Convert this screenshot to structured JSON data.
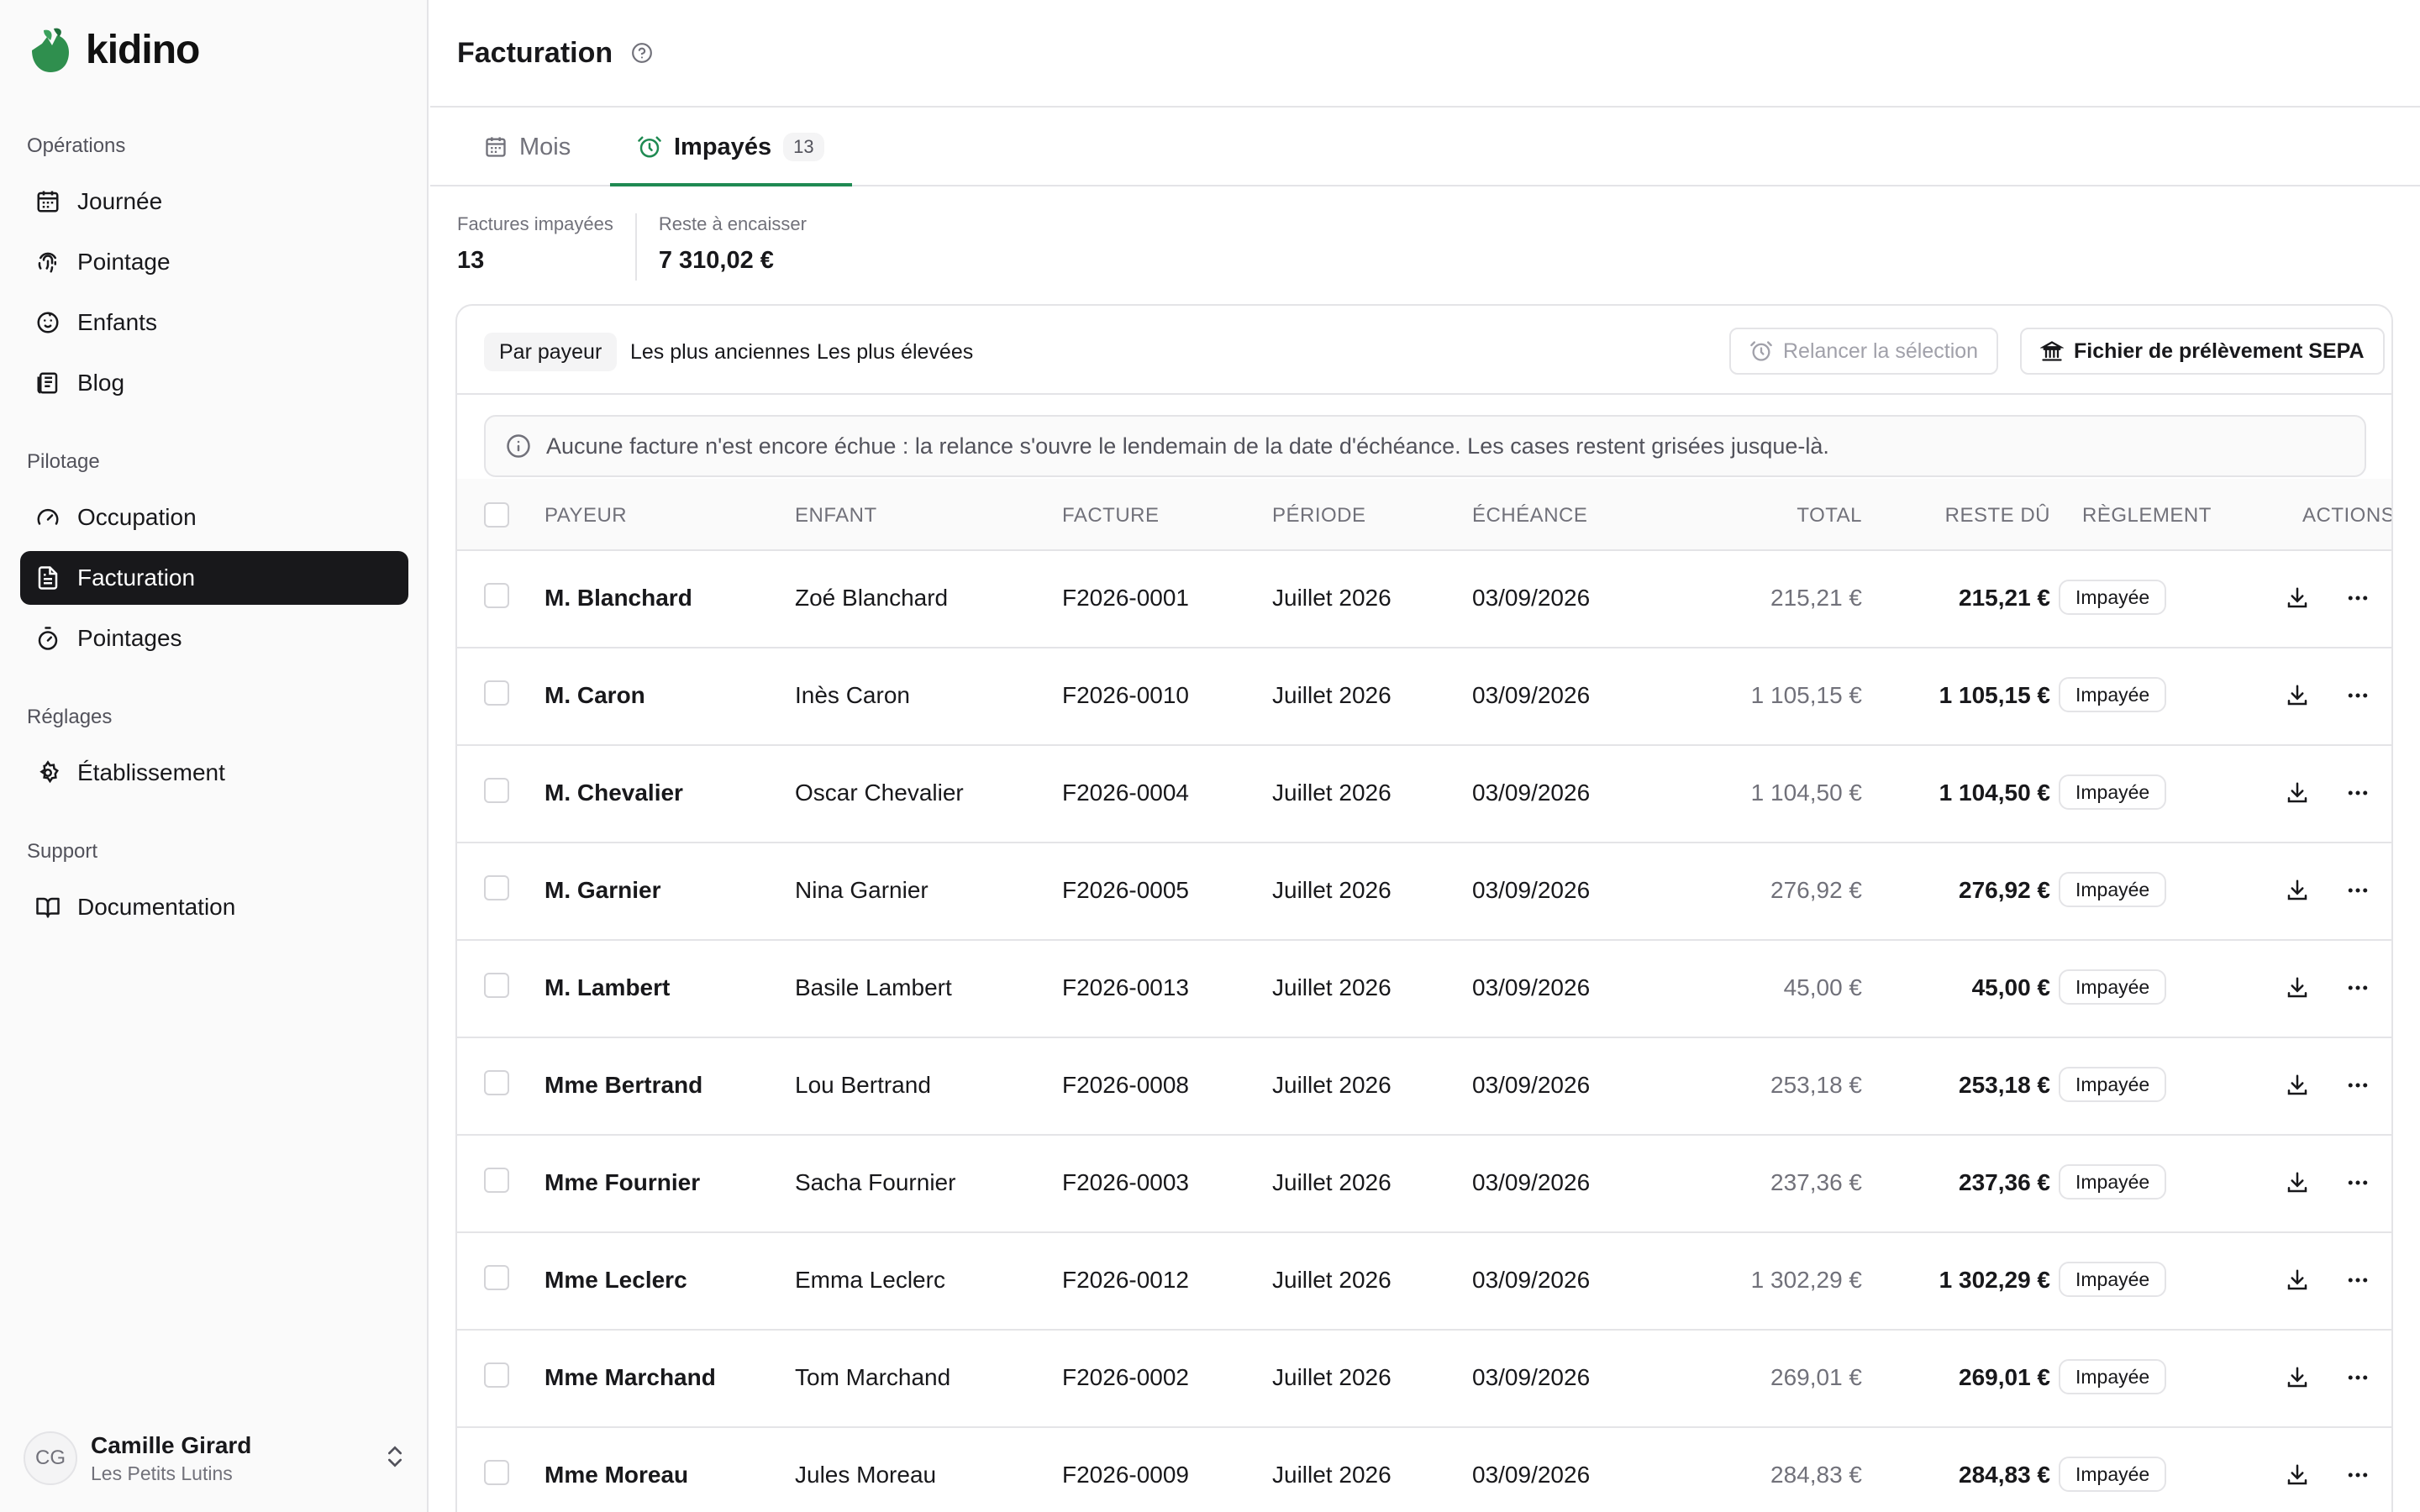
{
  "brand": {
    "name": "kidino",
    "accent": "#2f8f4e"
  },
  "sidebar": {
    "groups": [
      {
        "label": "Opérations",
        "items": [
          {
            "label": "Journée",
            "icon": "calendar-icon"
          },
          {
            "label": "Pointage",
            "icon": "fingerprint-icon"
          },
          {
            "label": "Enfants",
            "icon": "baby-icon"
          },
          {
            "label": "Blog",
            "icon": "newspaper-icon"
          }
        ]
      },
      {
        "label": "Pilotage",
        "items": [
          {
            "label": "Occupation",
            "icon": "gauge-icon"
          },
          {
            "label": "Facturation",
            "icon": "receipt-icon",
            "active": true
          },
          {
            "label": "Pointages",
            "icon": "timer-icon"
          }
        ]
      },
      {
        "label": "Réglages",
        "items": [
          {
            "label": "Établissement",
            "icon": "gear-icon"
          }
        ]
      },
      {
        "label": "Support",
        "items": [
          {
            "label": "Documentation",
            "icon": "book-icon"
          }
        ]
      }
    ],
    "user": {
      "initials": "CG",
      "name": "Camille Girard",
      "org": "Les Petits Lutins"
    }
  },
  "header": {
    "title": "Facturation"
  },
  "tabs": [
    {
      "label": "Mois",
      "icon": "calendar-icon"
    },
    {
      "label": "Impayés",
      "icon": "alarm-clock-icon",
      "count": "13",
      "active": true
    }
  ],
  "stats": [
    {
      "label": "Factures impayées",
      "value": "13"
    },
    {
      "label": "Reste à encaisser",
      "value": "7 310,02 €"
    }
  ],
  "toolbar": {
    "sorts": [
      "Par payeur",
      "Les plus anciennes",
      "Les plus élevées"
    ],
    "active_sort": "Par payeur",
    "remind_label": "Relancer la sélection",
    "sepa_label": "Fichier de prélèvement SEPA"
  },
  "notice": "Aucune facture n'est encore échue : la relance s'ouvre le lendemain de la date d'échéance. Les cases restent grisées jusque-là.",
  "table": {
    "columns": [
      "PAYEUR",
      "ENFANT",
      "FACTURE",
      "PÉRIODE",
      "ÉCHÉANCE",
      "TOTAL",
      "RESTE DÛ",
      "RÈGLEMENT",
      "ACTIONS"
    ],
    "rows": [
      {
        "payer": "M. Blanchard",
        "child": "Zoé Blanchard",
        "invoice": "F2026-0001",
        "period": "Juillet 2026",
        "due_date": "03/09/2026",
        "total": "215,21 €",
        "remaining": "215,21 €",
        "status": "Impayée"
      },
      {
        "payer": "M. Caron",
        "child": "Inès Caron",
        "invoice": "F2026-0010",
        "period": "Juillet 2026",
        "due_date": "03/09/2026",
        "total": "1 105,15 €",
        "remaining": "1 105,15 €",
        "status": "Impayée"
      },
      {
        "payer": "M. Chevalier",
        "child": "Oscar Chevalier",
        "invoice": "F2026-0004",
        "period": "Juillet 2026",
        "due_date": "03/09/2026",
        "total": "1 104,50 €",
        "remaining": "1 104,50 €",
        "status": "Impayée"
      },
      {
        "payer": "M. Garnier",
        "child": "Nina Garnier",
        "invoice": "F2026-0005",
        "period": "Juillet 2026",
        "due_date": "03/09/2026",
        "total": "276,92 €",
        "remaining": "276,92 €",
        "status": "Impayée"
      },
      {
        "payer": "M. Lambert",
        "child": "Basile Lambert",
        "invoice": "F2026-0013",
        "period": "Juillet 2026",
        "due_date": "03/09/2026",
        "total": "45,00 €",
        "remaining": "45,00 €",
        "status": "Impayée"
      },
      {
        "payer": "Mme Bertrand",
        "child": "Lou Bertrand",
        "invoice": "F2026-0008",
        "period": "Juillet 2026",
        "due_date": "03/09/2026",
        "total": "253,18 €",
        "remaining": "253,18 €",
        "status": "Impayée"
      },
      {
        "payer": "Mme Fournier",
        "child": "Sacha Fournier",
        "invoice": "F2026-0003",
        "period": "Juillet 2026",
        "due_date": "03/09/2026",
        "total": "237,36 €",
        "remaining": "237,36 €",
        "status": "Impayée"
      },
      {
        "payer": "Mme Leclerc",
        "child": "Emma Leclerc",
        "invoice": "F2026-0012",
        "period": "Juillet 2026",
        "due_date": "03/09/2026",
        "total": "1 302,29 €",
        "remaining": "1 302,29 €",
        "status": "Impayée"
      },
      {
        "payer": "Mme Marchand",
        "child": "Tom Marchand",
        "invoice": "F2026-0002",
        "period": "Juillet 2026",
        "due_date": "03/09/2026",
        "total": "269,01 €",
        "remaining": "269,01 €",
        "status": "Impayée"
      },
      {
        "payer": "Mme Moreau",
        "child": "Jules Moreau",
        "invoice": "F2026-0009",
        "period": "Juillet 2026",
        "due_date": "03/09/2026",
        "total": "284,83 €",
        "remaining": "284,83 €",
        "status": "Impayée"
      }
    ]
  }
}
